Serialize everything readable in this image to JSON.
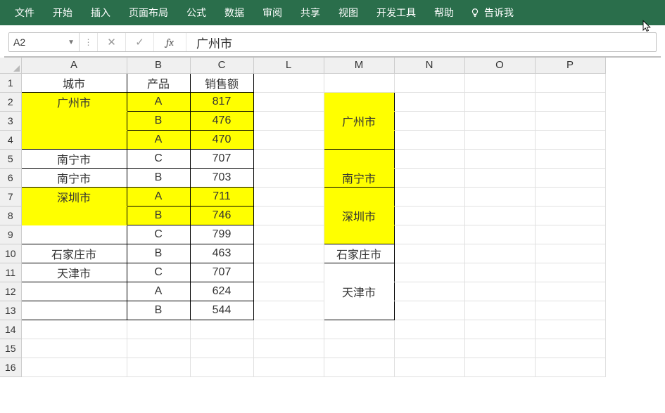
{
  "ribbon": {
    "tabs": [
      "文件",
      "开始",
      "插入",
      "页面布局",
      "公式",
      "数据",
      "审阅",
      "共享",
      "视图",
      "开发工具",
      "帮助"
    ],
    "tellMe": "告诉我"
  },
  "formulaBar": {
    "nameBox": "A2",
    "fx": "fx",
    "value": "广州市"
  },
  "columns": [
    "A",
    "B",
    "C",
    "L",
    "M",
    "N",
    "O",
    "P"
  ],
  "rows": [
    "1",
    "2",
    "3",
    "4",
    "5",
    "6",
    "7",
    "8",
    "9",
    "10",
    "11",
    "12",
    "13",
    "14",
    "15",
    "16"
  ],
  "colWidths": {
    "A": 150,
    "B": 90,
    "C": 90,
    "L": 100,
    "M": 100,
    "N": 100,
    "O": 100,
    "P": 100
  },
  "cells": {
    "A1": {
      "v": "城市",
      "bord": "trlb"
    },
    "B1": {
      "v": "产品",
      "bord": "trlb"
    },
    "C1": {
      "v": "销售额",
      "bord": "trlb"
    },
    "A2": {
      "v": "广州市",
      "bord": "trl",
      "fill": "Y",
      "noBot": "Y"
    },
    "B2": {
      "v": "A",
      "bord": "trlb",
      "fill": "Y"
    },
    "C2": {
      "v": "817",
      "bord": "trlb",
      "fill": "Y"
    },
    "A3": {
      "v": "",
      "bord": "rl",
      "fill": "Y",
      "noBot": "Y"
    },
    "B3": {
      "v": "B",
      "bord": "trlb",
      "fill": "Y"
    },
    "C3": {
      "v": "476",
      "bord": "trlb",
      "fill": "Y"
    },
    "A4": {
      "v": "",
      "bord": "rlb",
      "fill": "Y"
    },
    "B4": {
      "v": "A",
      "bord": "trlb",
      "fill": "Y"
    },
    "C4": {
      "v": "470",
      "bord": "trlb",
      "fill": "Y"
    },
    "A5": {
      "v": "南宁市",
      "bord": "trlb"
    },
    "B5": {
      "v": "C",
      "bord": "trlb"
    },
    "C5": {
      "v": "707",
      "bord": "trlb"
    },
    "A6": {
      "v": "南宁市",
      "bord": "trlb"
    },
    "B6": {
      "v": "B",
      "bord": "trlb"
    },
    "C6": {
      "v": "703",
      "bord": "trlb"
    },
    "A7": {
      "v": "深圳市",
      "bord": "trl",
      "fill": "Y",
      "noBot": "Y"
    },
    "B7": {
      "v": "A",
      "bord": "trlb",
      "fill": "Y"
    },
    "C7": {
      "v": "711",
      "bord": "trlb",
      "fill": "Y"
    },
    "A8": {
      "v": "",
      "bord": "rl",
      "fill": "Y",
      "noBot": "Y"
    },
    "B8": {
      "v": "B",
      "bord": "trlb",
      "fill": "Y"
    },
    "C8": {
      "v": "746",
      "bord": "trlb",
      "fill": "Y"
    },
    "A9": {
      "v": "",
      "bord": "rlb"
    },
    "B9": {
      "v": "C",
      "bord": "trlb"
    },
    "C9": {
      "v": "799",
      "bord": "trlb"
    },
    "A10": {
      "v": "石家庄市",
      "bord": "trlb"
    },
    "B10": {
      "v": "B",
      "bord": "trlb"
    },
    "C10": {
      "v": "463",
      "bord": "trlb"
    },
    "A11": {
      "v": "天津市",
      "bord": "trlb"
    },
    "B11": {
      "v": "C",
      "bord": "trlb"
    },
    "C11": {
      "v": "707",
      "bord": "trlb"
    },
    "A12": {
      "v": "",
      "bord": "rlb"
    },
    "B12": {
      "v": "A",
      "bord": "trlb"
    },
    "C12": {
      "v": "624",
      "bord": "trlb"
    },
    "A13": {
      "v": "",
      "bord": "rlb"
    },
    "B13": {
      "v": "B",
      "bord": "trlb"
    },
    "C13": {
      "v": "544",
      "bord": "trlb"
    },
    "M2": {
      "v": "",
      "bord": "trl",
      "fill": "Y",
      "noBot": "Y"
    },
    "M3": {
      "v": "广州市",
      "bord": "rl",
      "fill": "Y",
      "noBot": "Y"
    },
    "M4": {
      "v": "",
      "bord": "rlb",
      "fill": "Y"
    },
    "M5": {
      "v": "",
      "bord": "rl",
      "fill": "Y",
      "noBot": "Y"
    },
    "M6": {
      "v": "南宁市",
      "bord": "rlb",
      "fill": "Y"
    },
    "M7": {
      "v": "",
      "bord": "rl",
      "fill": "Y",
      "noBot": "Y"
    },
    "M8": {
      "v": "深圳市",
      "bord": "rl",
      "fill": "Y",
      "noBot": "Y"
    },
    "M9": {
      "v": "",
      "bord": "rlb",
      "fill": "Y"
    },
    "M10": {
      "v": "石家庄市",
      "bord": "trlb"
    },
    "M11": {
      "v": "",
      "bord": "rl",
      "noBot": "W"
    },
    "M12": {
      "v": "天津市",
      "bord": "rl",
      "noBot": "W"
    },
    "M13": {
      "v": "",
      "bord": "rlb"
    }
  }
}
